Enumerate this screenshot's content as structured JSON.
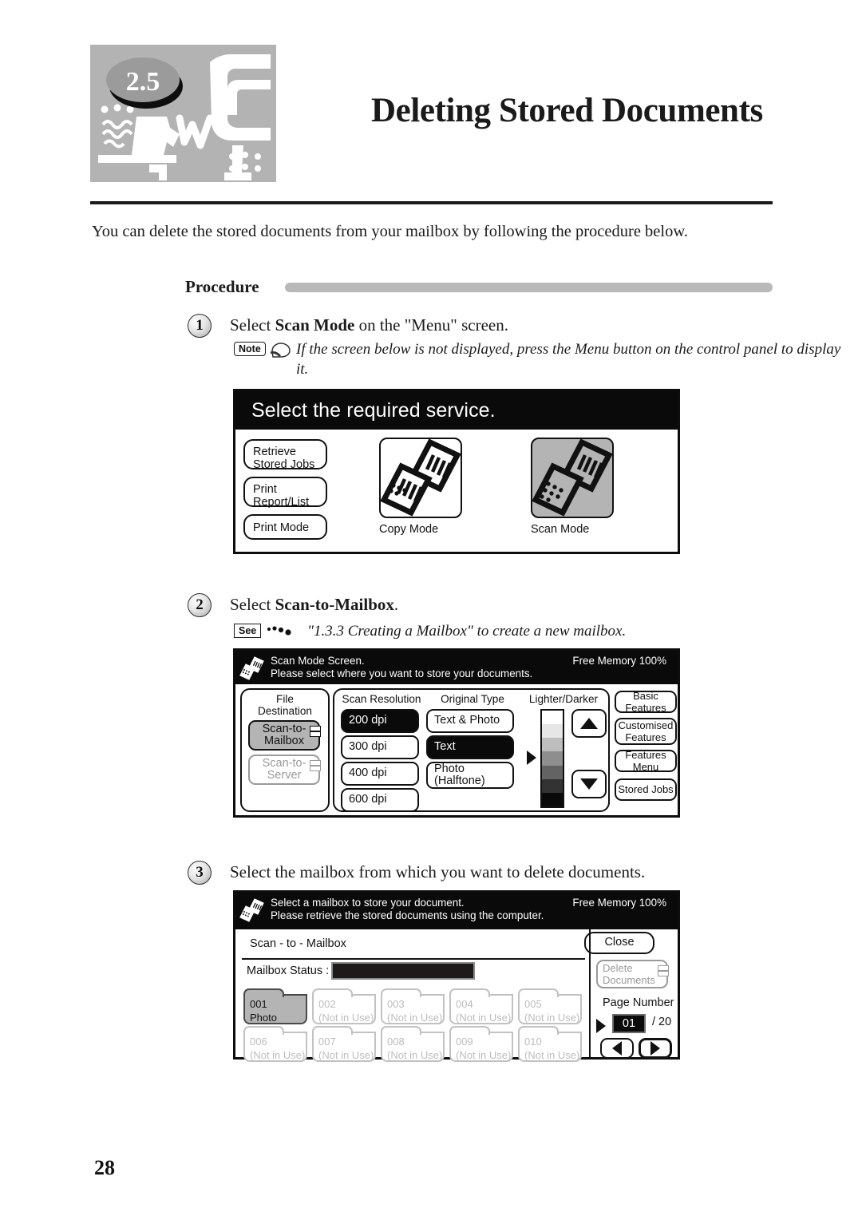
{
  "header": {
    "section_number": "2.5",
    "title": "Deleting Stored Documents"
  },
  "intro": "You can delete the stored documents from your mailbox by following the procedure below.",
  "procedure": {
    "label": "Procedure"
  },
  "steps": [
    {
      "number": "1",
      "text_before": "Select ",
      "text_bold": "Scan Mode",
      "text_after": " on the \"Menu\" screen.",
      "note_badge": "Note",
      "note_text": "If the screen below is not displayed, press the Menu button on the control panel to display it."
    },
    {
      "number": "2",
      "text_before": "Select ",
      "text_bold": "Scan-to-Mailbox",
      "text_after": ".",
      "see_badge": "See",
      "see_text": "\"1.3.3  Creating a Mailbox\" to create a new mailbox."
    },
    {
      "number": "3",
      "text_plain": "Select the mailbox from which you want to delete documents."
    }
  ],
  "screen1": {
    "title": "Select the required service.",
    "left_buttons": [
      {
        "line1": "Retrieve",
        "line2": "Stored Jobs"
      },
      {
        "line1": "Print",
        "line2": "Report/List"
      },
      {
        "line1": "Print Mode",
        "line2": ""
      }
    ],
    "modes": [
      {
        "caption": "Copy Mode",
        "selected": false
      },
      {
        "caption": "Scan Mode",
        "selected": true
      }
    ]
  },
  "screen2": {
    "header_line1": "Scan Mode Screen.",
    "header_line2": "Please select where you want to store your documents.",
    "free_memory": "Free Memory  100%",
    "file_destination": {
      "title_line1": "File",
      "title_line2": "Destination",
      "options": [
        {
          "line1": "Scan-to-",
          "line2": "Mailbox",
          "state": "selected"
        },
        {
          "line1": "Scan-to-",
          "line2": "Server",
          "state": "disabled"
        }
      ]
    },
    "scan_resolution": {
      "title": "Scan Resolution",
      "options": [
        {
          "label": "200 dpi",
          "state": "selected"
        },
        {
          "label": "300 dpi",
          "state": "normal"
        },
        {
          "label": "400 dpi",
          "state": "normal"
        },
        {
          "label": "600 dpi",
          "state": "normal"
        }
      ]
    },
    "original_type": {
      "title": "Original Type",
      "options": [
        {
          "label": "Text & Photo",
          "state": "normal"
        },
        {
          "label": "Text",
          "state": "selected"
        },
        {
          "label": "Photo\n(Halftone)",
          "line1": "Photo",
          "line2": "(Halftone)",
          "state": "normal"
        }
      ]
    },
    "lighter_darker": {
      "title": "Lighter/Darker",
      "levels": 7,
      "pointer_level": 4,
      "up_icon": "triangle-up-icon",
      "down_icon": "triangle-down-icon"
    },
    "right_buttons": [
      {
        "line1": "Basic Features",
        "line2": ""
      },
      {
        "line1": "Customised",
        "line2": "Features"
      },
      {
        "line1": "Features Menu",
        "line2": ""
      },
      {
        "line1": "Stored Jobs",
        "line2": ""
      }
    ]
  },
  "screen3": {
    "header_line1": "Select a mailbox to store your document.",
    "header_line2": "Please retrieve the stored documents using the computer.",
    "free_memory": "Free Memory  100%",
    "tab_label": "Scan - to - Mailbox",
    "close_button": "Close",
    "mailbox_status_label": "Mailbox Status :",
    "delete_button": {
      "line1": "Delete",
      "line2": "Documents"
    },
    "page_number_label": "Page Number",
    "page_current": "01",
    "page_total": "/ 20",
    "mailboxes": [
      {
        "num": "001",
        "status": "Photo",
        "active": true
      },
      {
        "num": "002",
        "status": "(Not in Use)",
        "active": false
      },
      {
        "num": "003",
        "status": "(Not in Use)",
        "active": false
      },
      {
        "num": "004",
        "status": "(Not in Use)",
        "active": false
      },
      {
        "num": "005",
        "status": "(Not in Use)",
        "active": false
      },
      {
        "num": "006",
        "status": "(Not in Use)",
        "active": false
      },
      {
        "num": "007",
        "status": "(Not in Use)",
        "active": false
      },
      {
        "num": "008",
        "status": "(Not in Use)",
        "active": false
      },
      {
        "num": "009",
        "status": "(Not in Use)",
        "active": false
      },
      {
        "num": "010",
        "status": "(Not in Use)",
        "active": false
      }
    ]
  },
  "footer": {
    "page": "28"
  },
  "colors": {
    "accent_grey": "#b3b3b3",
    "lcd_black": "#0a0a0a",
    "selected_grey": "#b4b4b4",
    "disabled_grey": "#9a9a9a"
  }
}
